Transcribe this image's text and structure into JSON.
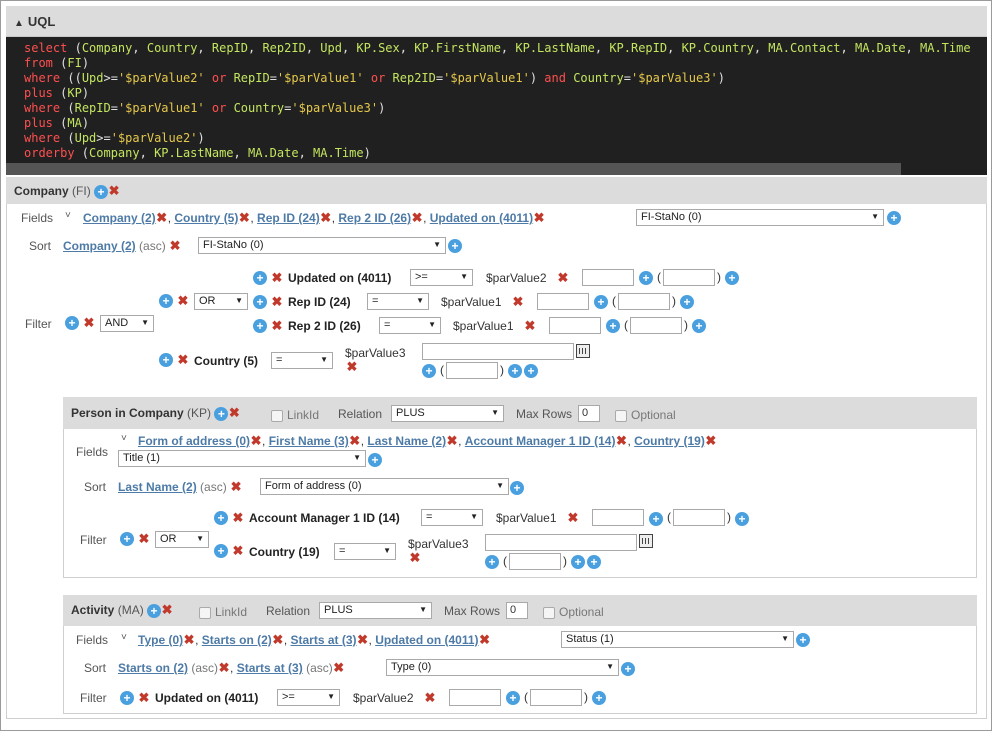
{
  "uql": {
    "title": "UQL",
    "lines": [
      [
        [
          "k",
          "select "
        ],
        [
          "p",
          "("
        ],
        [
          "g",
          "Company"
        ],
        [
          "p",
          ", "
        ],
        [
          "g",
          "Country"
        ],
        [
          "p",
          ", "
        ],
        [
          "g",
          "RepID"
        ],
        [
          "p",
          ", "
        ],
        [
          "g",
          "Rep2ID"
        ],
        [
          "p",
          ", "
        ],
        [
          "g",
          "Upd"
        ],
        [
          "p",
          ", "
        ],
        [
          "g",
          "KP.Sex"
        ],
        [
          "p",
          ", "
        ],
        [
          "g",
          "KP.FirstName"
        ],
        [
          "p",
          ", "
        ],
        [
          "g",
          "KP.LastName"
        ],
        [
          "p",
          ", "
        ],
        [
          "g",
          "KP.RepID"
        ],
        [
          "p",
          ", "
        ],
        [
          "g",
          "KP.Country"
        ],
        [
          "p",
          ", "
        ],
        [
          "g",
          "MA.Contact"
        ],
        [
          "p",
          ", "
        ],
        [
          "g",
          "MA.Date"
        ],
        [
          "p",
          ", "
        ],
        [
          "g",
          "MA.Time"
        ]
      ],
      [
        [
          "k",
          "from "
        ],
        [
          "p",
          "("
        ],
        [
          "g",
          "FI"
        ],
        [
          "p",
          ")"
        ]
      ],
      [
        [
          "k",
          "where "
        ],
        [
          "p",
          "(("
        ],
        [
          "g",
          "Upd"
        ],
        [
          "p",
          ">="
        ],
        [
          "s",
          "'$parValue2'"
        ],
        [
          "k",
          " or "
        ],
        [
          "g",
          "RepID"
        ],
        [
          "p",
          "="
        ],
        [
          "s",
          "'$parValue1'"
        ],
        [
          "k",
          " or "
        ],
        [
          "g",
          "Rep2ID"
        ],
        [
          "p",
          "="
        ],
        [
          "s",
          "'$parValue1'"
        ],
        [
          "p",
          ") "
        ],
        [
          "k",
          "and "
        ],
        [
          "g",
          "Country"
        ],
        [
          "p",
          "="
        ],
        [
          "s",
          "'$parValue3'"
        ],
        [
          "p",
          ")"
        ]
      ],
      [
        [
          "k",
          "plus "
        ],
        [
          "p",
          "("
        ],
        [
          "g",
          "KP"
        ],
        [
          "p",
          ")"
        ]
      ],
      [
        [
          "k",
          "where "
        ],
        [
          "p",
          "("
        ],
        [
          "g",
          "RepID"
        ],
        [
          "p",
          "="
        ],
        [
          "s",
          "'$parValue1'"
        ],
        [
          "k",
          " or "
        ],
        [
          "g",
          "Country"
        ],
        [
          "p",
          "="
        ],
        [
          "s",
          "'$parValue3'"
        ],
        [
          "p",
          ")"
        ]
      ],
      [
        [
          "k",
          "plus "
        ],
        [
          "p",
          "("
        ],
        [
          "g",
          "MA"
        ],
        [
          "p",
          ")"
        ]
      ],
      [
        [
          "k",
          "where "
        ],
        [
          "p",
          "("
        ],
        [
          "g",
          "Upd"
        ],
        [
          "p",
          ">="
        ],
        [
          "s",
          "'$parValue2'"
        ],
        [
          "p",
          ")"
        ]
      ],
      [
        [
          "k",
          "orderby "
        ],
        [
          "p",
          "("
        ],
        [
          "g",
          "Company"
        ],
        [
          "p",
          ", "
        ],
        [
          "g",
          "KP.LastName"
        ],
        [
          "p",
          ", "
        ],
        [
          "g",
          "MA.Date"
        ],
        [
          "p",
          ", "
        ],
        [
          "g",
          "MA.Time"
        ],
        [
          "p",
          ")"
        ]
      ]
    ]
  },
  "company": {
    "title": "Company",
    "code": "(FI)",
    "fields_label": "Fields",
    "sort_label": "Sort",
    "filter_label": "Filter",
    "fields": [
      "Company (2)",
      "Country (5)",
      "Rep ID (24)",
      "Rep 2 ID (26)",
      "Updated on (4011)"
    ],
    "fields_select": "FI-StaNo (0)",
    "sort_field": "Company (2)",
    "sort_dir": "(asc)",
    "sort_select": "FI-StaNo (0)",
    "filter_op": "AND",
    "sub_op": "OR",
    "conds": [
      {
        "field": "Updated on (4011)",
        "op": ">=",
        "param": "$parValue2"
      },
      {
        "field": "Rep ID (24)",
        "op": "=",
        "param": "$parValue1"
      },
      {
        "field": "Rep 2 ID (26)",
        "op": "=",
        "param": "$parValue1"
      },
      {
        "field": "Country (5)",
        "op": "=",
        "param": "$parValue3"
      }
    ]
  },
  "person": {
    "title": "Person in Company",
    "code": "(KP)",
    "linkid": "LinkId",
    "relation_label": "Relation",
    "relation": "PLUS",
    "maxrows_label": "Max Rows",
    "maxrows": "0",
    "optional": "Optional",
    "fields_label": "Fields",
    "sort_label": "Sort",
    "filter_label": "Filter",
    "fields": [
      "Form of address (0)",
      "First Name (3)",
      "Last Name (2)",
      "Account Manager 1 ID (14)",
      "Country (19)"
    ],
    "fields_select": "Title (1)",
    "sort_field": "Last Name (2)",
    "sort_dir": "(asc)",
    "sort_select": "Form of address (0)",
    "filter_op": "OR",
    "conds": [
      {
        "field": "Account Manager 1 ID (14)",
        "op": "=",
        "param": "$parValue1"
      },
      {
        "field": "Country (19)",
        "op": "=",
        "param": "$parValue3"
      }
    ]
  },
  "activity": {
    "title": "Activity",
    "code": "(MA)",
    "linkid": "LinkId",
    "relation_label": "Relation",
    "relation": "PLUS",
    "maxrows_label": "Max Rows",
    "maxrows": "0",
    "optional": "Optional",
    "fields_label": "Fields",
    "sort_label": "Sort",
    "filter_label": "Filter",
    "fields": [
      "Type (0)",
      "Starts on (2)",
      "Starts at (3)",
      "Updated on (4011)"
    ],
    "fields_select": "Status (1)",
    "sort_fields": [
      "Starts on (2)",
      "Starts at (3)"
    ],
    "sort_dir": "(asc)",
    "sort_select": "Type (0)",
    "cond": {
      "field": "Updated on (4011)",
      "op": ">=",
      "param": "$parValue2"
    }
  },
  "icons": {
    "plus": "+",
    "remove": "✖",
    "collapse": "^",
    "expand": "˅"
  },
  "colors": {
    "link": "#4d7aa6",
    "remove": "#c0392b",
    "plus": "#4aa0df",
    "code_bg": "#202020",
    "keyword": "#ff4f4f",
    "ident": "#c3e55f",
    "string": "#e5c84b"
  }
}
